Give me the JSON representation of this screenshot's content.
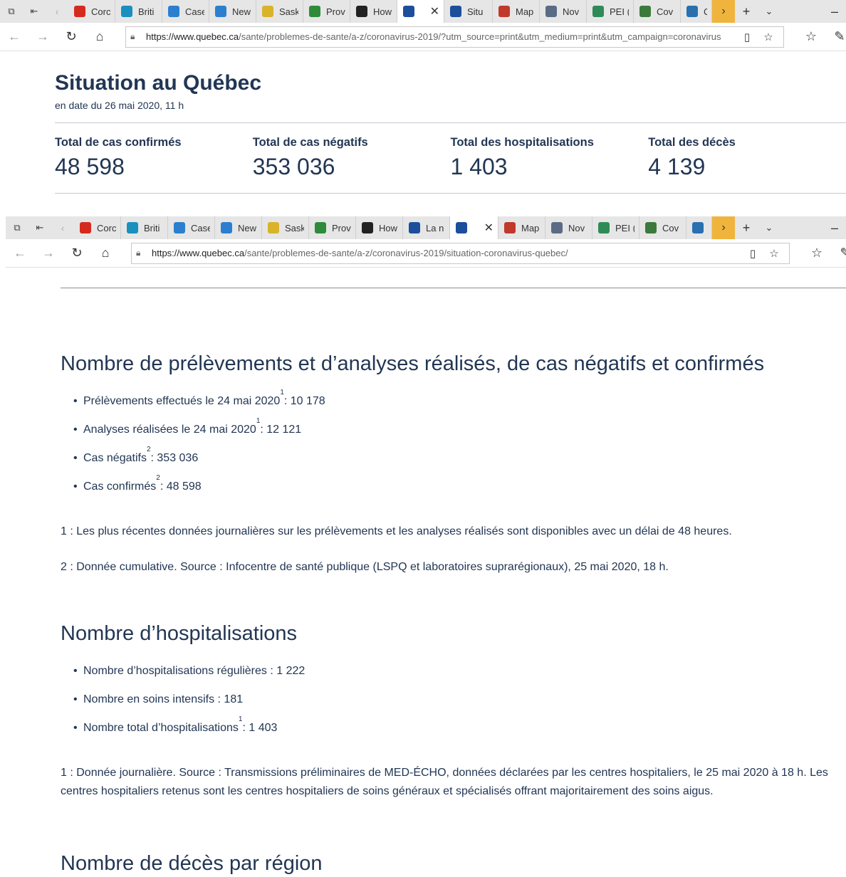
{
  "browser_top": {
    "tabs": [
      {
        "label": "Corc",
        "icon": "canada-flag-icon",
        "color": "#d52b1e"
      },
      {
        "label": "Briti",
        "icon": "bc-icon",
        "color": "#1b8fbd"
      },
      {
        "label": "Case",
        "icon": "chart-icon",
        "color": "#2c7fcf"
      },
      {
        "label": "New",
        "icon": "chart-icon",
        "color": "#2c7fcf"
      },
      {
        "label": "Sask",
        "icon": "wheat-icon",
        "color": "#d9b32a"
      },
      {
        "label": "Prov",
        "icon": "green-card-icon",
        "color": "#2e8b3a"
      },
      {
        "label": "How",
        "icon": "shield-icon",
        "color": "#222222"
      },
      {
        "label": "",
        "icon": "quebec-flag-icon",
        "color": "#1c4e9c",
        "active": true
      },
      {
        "label": "Situ",
        "icon": "quebec-flag-icon",
        "color": "#1c4e9c"
      },
      {
        "label": "Map",
        "icon": "map-icon",
        "color": "#c0392b"
      },
      {
        "label": "Nov",
        "icon": "ns-icon",
        "color": "#5a6b85"
      },
      {
        "label": "PEI (",
        "icon": "pei-icon",
        "color": "#2e8b57"
      },
      {
        "label": "Cov",
        "icon": "globe-icon",
        "color": "#3b7a3b"
      },
      {
        "label": "C",
        "icon": "nb-icon",
        "color": "#2a6fb0"
      }
    ],
    "url_host": "https://www.quebec.ca",
    "url_path": "/sante/problemes-de-sante/a-z/coronavirus-2019/?utm_source=print&utm_medium=print&utm_campaign=coronavirus"
  },
  "situation": {
    "title": "Situation au Québec",
    "date": "en date du 26 mai 2020, 11 h",
    "stats": [
      {
        "label": "Total de cas confirmés",
        "value": "48 598"
      },
      {
        "label": "Total de cas négatifs",
        "value": "353 036"
      },
      {
        "label": "Total des hospitalisations",
        "value": "1 403"
      },
      {
        "label": "Total des décès",
        "value": "4 139"
      }
    ]
  },
  "browser_bottom": {
    "tabs": [
      {
        "label": "Corc",
        "icon": "canada-flag-icon",
        "color": "#d52b1e"
      },
      {
        "label": "Briti",
        "icon": "bc-icon",
        "color": "#1b8fbd"
      },
      {
        "label": "Case",
        "icon": "chart-icon",
        "color": "#2c7fcf"
      },
      {
        "label": "New",
        "icon": "chart-icon",
        "color": "#2c7fcf"
      },
      {
        "label": "Sask",
        "icon": "wheat-icon",
        "color": "#d9b32a"
      },
      {
        "label": "Prov",
        "icon": "green-card-icon",
        "color": "#2e8b3a"
      },
      {
        "label": "How",
        "icon": "shield-icon",
        "color": "#222222"
      },
      {
        "label": "La n",
        "icon": "quebec-flag-icon",
        "color": "#1c4e9c"
      },
      {
        "label": "",
        "icon": "quebec-flag-icon",
        "color": "#1c4e9c",
        "active": true
      },
      {
        "label": "Map",
        "icon": "map-icon",
        "color": "#c0392b"
      },
      {
        "label": "Nov",
        "icon": "ns-icon",
        "color": "#5a6b85"
      },
      {
        "label": "PEI (",
        "icon": "pei-icon",
        "color": "#2e8b57"
      },
      {
        "label": "Cov",
        "icon": "globe-icon",
        "color": "#3b7a3b"
      },
      {
        "label": "C",
        "icon": "nb-icon",
        "color": "#2a6fb0"
      }
    ],
    "url_host": "https://www.quebec.ca",
    "url_path": "/sante/problemes-de-sante/a-z/coronavirus-2019/situation-coronavirus-quebec/"
  },
  "tests_section": {
    "heading": "Nombre de prélèvements et d’analyses réalisés, de cas négatifs et confirmés",
    "items": [
      {
        "text": "Prélèvements effectués le 24 mai 2020",
        "sup": "1",
        "value": " : 10 178"
      },
      {
        "text": "Analyses réalisées le 24 mai 2020",
        "sup": "1",
        "value": " : 12 121"
      },
      {
        "text": "Cas négatifs",
        "sup": "2",
        "value": " : 353 036"
      },
      {
        "text": "Cas confirmés",
        "sup": "2",
        "value": " : 48 598"
      }
    ],
    "note1": "1 : Les plus récentes données journalières sur les prélèvements et les analyses réalisés sont disponibles avec un délai de 48 heures.",
    "note2": "2 : Donnée cumulative. Source : Infocentre de santé publique (LSPQ et laboratoires suprarégionaux), 25 mai 2020, 18 h."
  },
  "hosp_section": {
    "heading": "Nombre d’hospitalisations",
    "items": [
      {
        "text": "Nombre d’hospitalisations régulières : 1 222",
        "sup": "",
        "value": ""
      },
      {
        "text": "Nombre en soins intensifs : 181",
        "sup": "",
        "value": ""
      },
      {
        "text": "Nombre total d’hospitalisations",
        "sup": "1",
        "value": " : 1 403"
      }
    ],
    "note1": "1 : Donnée journalière. Source : Transmissions préliminaires de MED-ÉCHO, données déclarées par les centres hospitaliers, le 25 mai 2020 à 18 h. Les centres hospitaliers retenus sont les centres hospitaliers de soins généraux et spécialisés offrant majoritairement des soins aigus."
  },
  "deaths_section": {
    "heading": "Nombre de décès par région"
  }
}
